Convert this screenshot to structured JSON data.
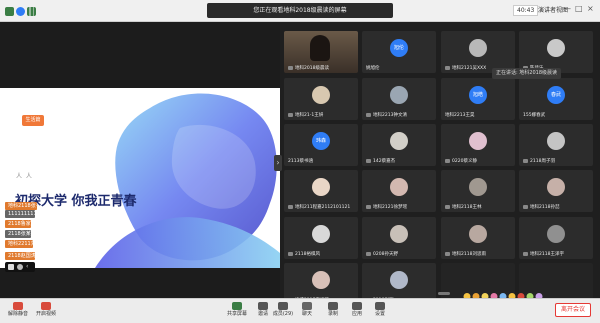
{
  "window": {
    "banner": "您正在观看地科2018级晨读的屏幕",
    "timer": "40:43",
    "view_toggle": "演讲者视图",
    "minimize": "—",
    "maximize": "□",
    "close": "×"
  },
  "slide": {
    "badge": "生活篇",
    "deco": "人 人",
    "title": "初探大学 你我正青春"
  },
  "chat": [
    {
      "text": "地科2118张书豪",
      "color": "#e07a2e"
    },
    {
      "text": "1111111111",
      "color": "#666666"
    },
    {
      "text": "2118鲁家辉",
      "color": "#e07a2e"
    },
    {
      "text": "2118张某 1",
      "color": "#666666"
    },
    {
      "text": "地科2211刘 1",
      "color": "#e07a2e"
    },
    {
      "text": "2118赵国涛 1",
      "color": "#e07a2e"
    }
  ],
  "speaking": "正在讲话: 地科2018级晨读",
  "participants": [
    {
      "name": "地科2018级晨读",
      "avatar": "",
      "color": "#8c6b55",
      "mic": true
    },
    {
      "name": "姚旭伦",
      "avatar": "旭伦",
      "color": "#2f7df6",
      "mic": false
    },
    {
      "name": "地科2121吴XXX",
      "avatar": "",
      "color": "#b8b8b8",
      "mic": true
    },
    {
      "name": "陈佳乐",
      "avatar": "",
      "color": "#c9c9c9",
      "mic": true
    },
    {
      "name": "",
      "avatar": "",
      "color": "",
      "mic": false
    },
    {
      "name": "地科21-1王妍",
      "avatar": "",
      "color": "#d8c8b0",
      "mic": true
    },
    {
      "name": "地科2213钟文清",
      "avatar": "",
      "color": "#9aa6b2",
      "mic": true
    },
    {
      "name": "地科2213王昊",
      "avatar": "旭皓",
      "color": "#2f7df6",
      "mic": false
    },
    {
      "name": "155娜春武",
      "avatar": "春武",
      "color": "#2f7df6",
      "mic": false
    },
    {
      "name": "",
      "avatar": "",
      "color": "",
      "mic": false
    },
    {
      "name": "2113蔡书涵",
      "avatar": "玮森",
      "color": "#2f7df6",
      "mic": false
    },
    {
      "name": "142蔡嘉杰",
      "avatar": "",
      "color": "#d2cfc8",
      "mic": true
    },
    {
      "name": "0220蔡义静",
      "avatar": "",
      "color": "#e0c0cf",
      "mic": true
    },
    {
      "name": "2118周子羽",
      "avatar": "",
      "color": "#c4c4c4",
      "mic": true
    },
    {
      "name": "2118陈欣怡",
      "avatar": "",
      "color": "#b0a090",
      "mic": true
    },
    {
      "name": "地科211程嘉2112101121",
      "avatar": "",
      "color": "#e9d6c6",
      "mic": true
    },
    {
      "name": "地科2121徐梦瑶",
      "avatar": "",
      "color": "#d3b8b0",
      "mic": true
    },
    {
      "name": "地科2118王林",
      "avatar": "",
      "color": "#a09890",
      "mic": true
    },
    {
      "name": "地科2118孙喆",
      "avatar": "",
      "color": "#c6b0a8",
      "mic": true
    },
    {
      "name": "地科2012李德华",
      "avatar": "",
      "color": "#e4a8c0",
      "mic": true
    },
    {
      "name": "2118裕棋风",
      "avatar": "",
      "color": "#d8d8d8",
      "mic": true
    },
    {
      "name": "0208孙天野",
      "avatar": "",
      "color": "#c8c0b8",
      "mic": true
    },
    {
      "name": "地科2118刘思雨",
      "avatar": "",
      "color": "#b8a8a0",
      "mic": true
    },
    {
      "name": "地科2118王泽宇",
      "avatar": "",
      "color": "#909090",
      "mic": true
    },
    {
      "name": "",
      "avatar": "",
      "color": "",
      "mic": false
    },
    {
      "name": "梅子2117王诗璇",
      "avatar": "",
      "color": "#d8c0b8",
      "mic": true
    },
    {
      "name": "2118张翔",
      "avatar": "",
      "color": "#b0b8c8",
      "mic": true
    },
    {
      "name": "",
      "avatar": "",
      "color": "",
      "mic": false
    },
    {
      "name": "",
      "avatar": "",
      "color": "",
      "mic": false
    }
  ],
  "toolbar": [
    {
      "label": "解除静音",
      "icon": "mic-muted-icon",
      "color": "#d84b3c"
    },
    {
      "label": "开启视频",
      "icon": "camera-off-icon",
      "color": "#d84b3c"
    },
    {
      "label": "共享屏幕",
      "icon": "share-screen-icon",
      "color": "#3a7d44"
    },
    {
      "label": "邀请",
      "icon": "invite-icon",
      "color": "#555555"
    },
    {
      "label": "成员(29)",
      "icon": "members-icon",
      "color": "#555555"
    },
    {
      "label": "聊天",
      "icon": "chat-icon",
      "color": "#555555"
    },
    {
      "label": "录制",
      "icon": "record-icon",
      "color": "#555555"
    },
    {
      "label": "应用",
      "icon": "apps-icon",
      "color": "#555555"
    },
    {
      "label": "设置",
      "icon": "settings-icon",
      "color": "#555555"
    }
  ],
  "leave": "离开会议",
  "accent": "#2f7df6"
}
